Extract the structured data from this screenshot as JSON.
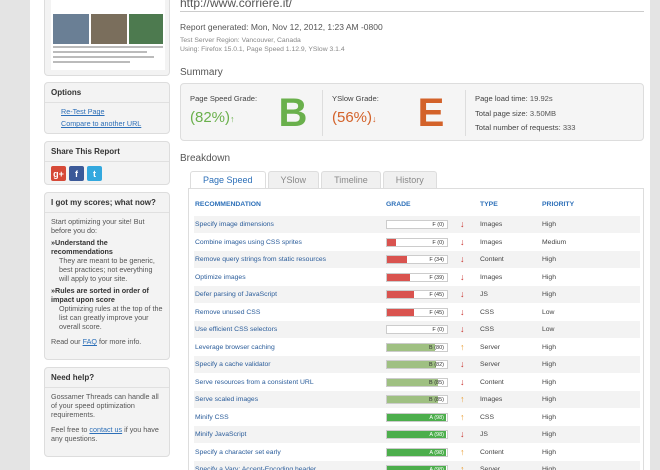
{
  "sidebar": {
    "options": {
      "title": "Options",
      "links": [
        "Re-Test Page",
        "Compare to another URL"
      ]
    },
    "share": {
      "title": "Share This Report",
      "icons": [
        {
          "name": "google-plus-icon",
          "glyph": "g+",
          "color": "#d64937"
        },
        {
          "name": "facebook-icon",
          "glyph": "f",
          "color": "#3b5998"
        },
        {
          "name": "twitter-icon",
          "glyph": "t",
          "color": "#33a8de"
        }
      ]
    },
    "scores": {
      "title": "I got my scores; what now?",
      "intro": "Start optimizing your site! But before you do:",
      "b1_title": "Understand the recommendations",
      "b1_text": "They are meant to be generic, best practices; not everything will apply to your site.",
      "b2_title": "Rules are sorted in order of impact upon score",
      "b2_text": "Optimizing rules at the top of the list can greatly improve your overall score.",
      "faq_pre": "Read our ",
      "faq_link": "FAQ",
      "faq_post": " for more info."
    },
    "help": {
      "title": "Need help?",
      "text": "Gossamer Threads can handle all of your speed optimization requirements.",
      "contact_pre": "Feel free to ",
      "contact_link": "contact us",
      "contact_post": " if you have any questions."
    }
  },
  "header": {
    "url": "http://www.corriere.it/",
    "report_generated": "Report generated: Mon, Nov 12, 2012, 1:23 AM -0800",
    "test_region": "Test Server Region: Vancouver, Canada",
    "using": "Using: Firefox 15.0.1, Page Speed 1.12.9, YSlow 3.1.4"
  },
  "summary": {
    "title": "Summary",
    "pagespeed_label": "Page Speed Grade:",
    "pagespeed_pct": "(82%)",
    "pagespeed_arrow": "↑",
    "pagespeed_letter": "B",
    "yslow_label": "YSlow Grade:",
    "yslow_pct": "(56%)",
    "yslow_arrow": "↓",
    "yslow_letter": "E",
    "load_time_label": "Page load time:",
    "load_time": "19.92s",
    "page_size_label": "Total page size:",
    "page_size": "3.50MB",
    "requests_label": "Total number of requests:",
    "requests": "333",
    "colors": {
      "good": "#6ab04c",
      "bad": "#d3622a"
    }
  },
  "breakdown": {
    "title": "Breakdown",
    "tabs": [
      "Page Speed",
      "YSlow",
      "Timeline",
      "History"
    ],
    "active_tab": 0,
    "columns": [
      "RECOMMENDATION",
      "GRADE",
      "TYPE",
      "PRIORITY"
    ],
    "rows": [
      {
        "rec": "Specify image dimensions",
        "grade": "F (0)",
        "pct": 0,
        "dir": "down",
        "type": "Images",
        "prio": "High"
      },
      {
        "rec": "Combine images using CSS sprites",
        "grade": "F (0)",
        "pct": 15,
        "dir": "down",
        "type": "Images",
        "prio": "Medium"
      },
      {
        "rec": "Remove query strings from static resources",
        "grade": "F (34)",
        "pct": 34,
        "dir": "down",
        "type": "Content",
        "prio": "High"
      },
      {
        "rec": "Optimize images",
        "grade": "F (39)",
        "pct": 39,
        "dir": "down",
        "type": "Images",
        "prio": "High"
      },
      {
        "rec": "Defer parsing of JavaScript",
        "grade": "F (45)",
        "pct": 45,
        "dir": "down",
        "type": "JS",
        "prio": "High"
      },
      {
        "rec": "Remove unused CSS",
        "grade": "F (45)",
        "pct": 45,
        "dir": "down",
        "type": "CSS",
        "prio": "Low"
      },
      {
        "rec": "Use efficient CSS selectors",
        "grade": "F (0)",
        "pct": 0,
        "dir": "down",
        "type": "CSS",
        "prio": "Low"
      },
      {
        "rec": "Leverage browser caching",
        "grade": "B (80)",
        "pct": 80,
        "dir": "up",
        "type": "Server",
        "prio": "High"
      },
      {
        "rec": "Specify a cache validator",
        "grade": "B (82)",
        "pct": 82,
        "dir": "down",
        "type": "Server",
        "prio": "High"
      },
      {
        "rec": "Serve resources from a consistent URL",
        "grade": "B (85)",
        "pct": 85,
        "dir": "down",
        "type": "Content",
        "prio": "High"
      },
      {
        "rec": "Serve scaled images",
        "grade": "B (85)",
        "pct": 85,
        "dir": "up",
        "type": "Images",
        "prio": "High"
      },
      {
        "rec": "Minify CSS",
        "grade": "A (98)",
        "pct": 98,
        "dir": "up",
        "type": "CSS",
        "prio": "High"
      },
      {
        "rec": "Minify JavaScript",
        "grade": "A (98)",
        "pct": 98,
        "dir": "down",
        "type": "JS",
        "prio": "High"
      },
      {
        "rec": "Specify a character set early",
        "grade": "A (98)",
        "pct": 98,
        "dir": "up",
        "type": "Content",
        "prio": "High"
      },
      {
        "rec": "Specify a Vary: Accept-Encoding header",
        "grade": "A (98)",
        "pct": 98,
        "dir": "up",
        "type": "Server",
        "prio": "High"
      }
    ],
    "colors": {
      "red": "#d9534f",
      "gray": "#9fc082",
      "green": "#4cae4c",
      "up": "#e89a2c",
      "down": "#c9302c"
    }
  }
}
